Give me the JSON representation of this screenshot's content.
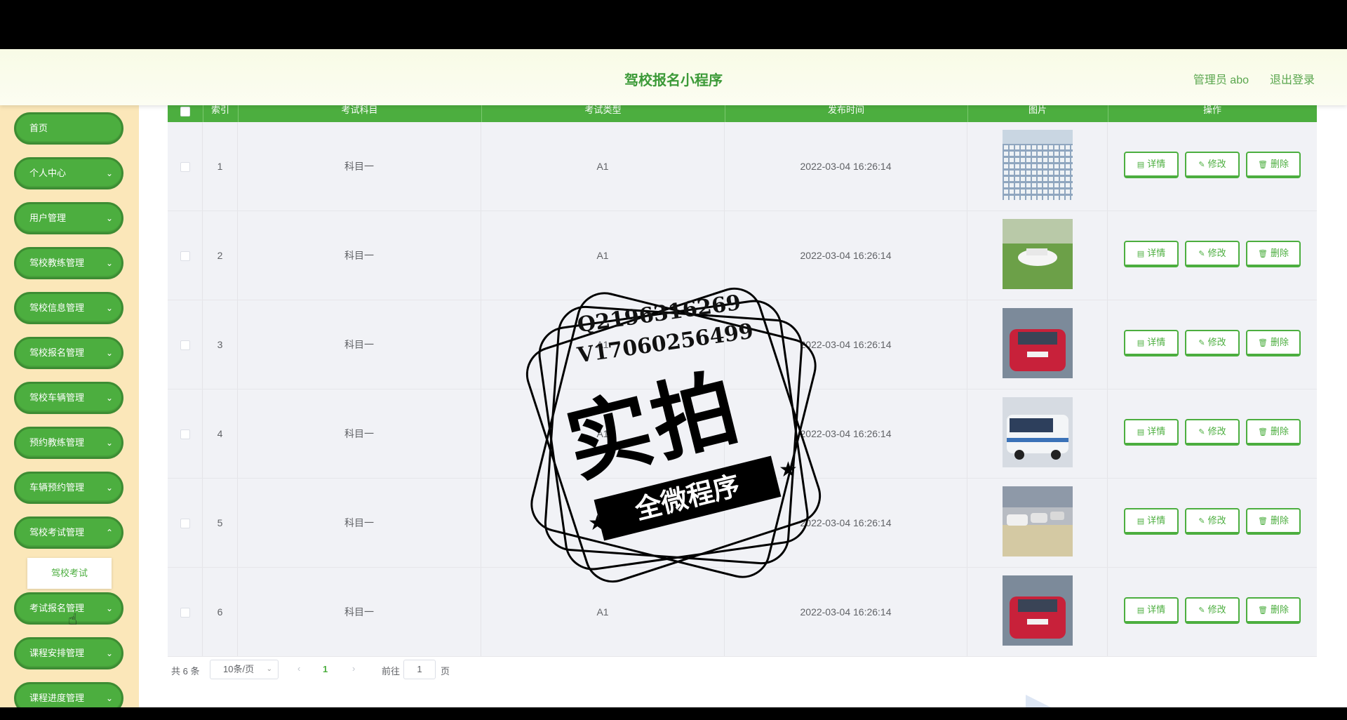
{
  "header": {
    "title": "驾校报名小程序",
    "user": "管理员 abo",
    "logout": "退出登录"
  },
  "sidebar": {
    "items": [
      {
        "label": "首页",
        "has_children": false
      },
      {
        "label": "个人中心",
        "has_children": true
      },
      {
        "label": "用户管理",
        "has_children": true
      },
      {
        "label": "驾校教练管理",
        "has_children": true
      },
      {
        "label": "驾校信息管理",
        "has_children": true
      },
      {
        "label": "驾校报名管理",
        "has_children": true
      },
      {
        "label": "驾校车辆管理",
        "has_children": true
      },
      {
        "label": "预约教练管理",
        "has_children": true
      },
      {
        "label": "车辆预约管理",
        "has_children": true
      },
      {
        "label": "驾校考试管理",
        "has_children": true
      },
      {
        "label": "考试报名管理",
        "has_children": true
      },
      {
        "label": "课程安排管理",
        "has_children": true
      },
      {
        "label": "课程进度管理",
        "has_children": true
      }
    ],
    "submenu": {
      "label": "驾校考试"
    }
  },
  "table": {
    "headers": [
      "索引",
      "考试科目",
      "考试类型",
      "发布时间",
      "图片",
      "操作"
    ],
    "rows": [
      {
        "index": "1",
        "subject": "科目一",
        "type": "A1",
        "time": "2022-03-04 16:26:14",
        "image": "parking-lot-cars"
      },
      {
        "index": "2",
        "subject": "科目一",
        "type": "A1",
        "time": "2022-03-04 16:26:14",
        "image": "white-car-on-grass"
      },
      {
        "index": "3",
        "subject": "科目一",
        "type": "A1",
        "time": "2022-03-04 16:26:14",
        "image": "red-training-car"
      },
      {
        "index": "4",
        "subject": "科目一",
        "type": "A1",
        "time": "2022-03-04 16:26:14",
        "image": "bus"
      },
      {
        "index": "5",
        "subject": "科目一",
        "type": "A1",
        "time": "2022-03-04 16:26:14",
        "image": "cars-lined-up"
      },
      {
        "index": "6",
        "subject": "科目一",
        "type": "A1",
        "time": "2022-03-04 16:26:14",
        "image": "red-training-car"
      }
    ],
    "actions": {
      "detail": "详情",
      "edit": "修改",
      "delete": "删除"
    }
  },
  "pagination": {
    "total": "共 6 条",
    "page_size": "10条/页",
    "current_page": "1",
    "goto_label": "前往",
    "goto_value": "1",
    "page_unit": "页"
  },
  "watermark": {
    "line1": "Q2196316269",
    "line2": "V17060256499",
    "big": "实拍",
    "ribbon": "全微程序"
  },
  "colors": {
    "primary": "#4cae3f",
    "sidebar_bg": "#fbe7b9",
    "header_bg": "#f8fbe6",
    "row_bg": "#f1f2f6"
  }
}
